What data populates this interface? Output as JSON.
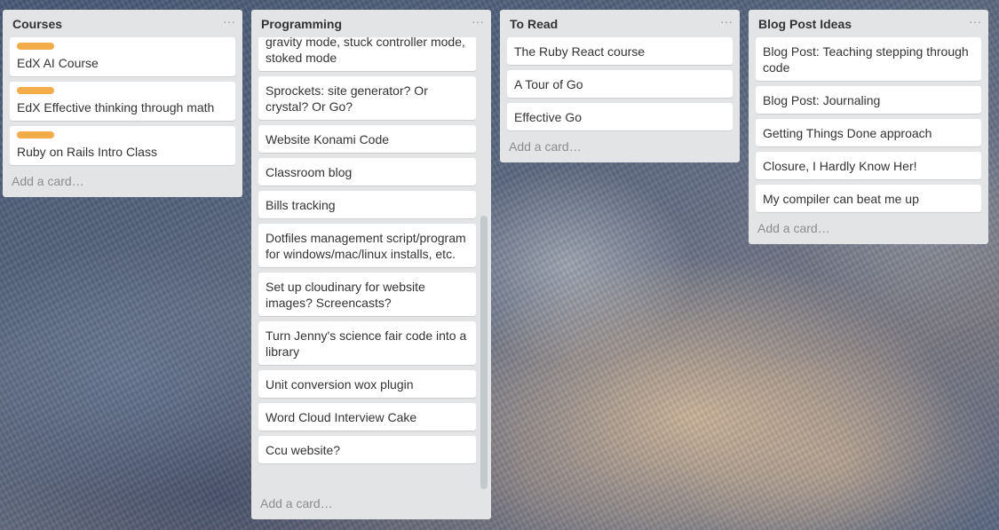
{
  "lists": [
    {
      "title": "Courses",
      "menu": "···",
      "add_card": "Add a card…",
      "cards": [
        {
          "text": "EdX AI Course",
          "label": true
        },
        {
          "text": "EdX Effective thinking through math",
          "label": true
        },
        {
          "text": "Ruby on Rails Intro Class",
          "label": true
        }
      ]
    },
    {
      "title": "Programming",
      "menu": "···",
      "add_card": "Add a card…",
      "cards": [
        {
          "text": "gravity mode, stuck controller mode, stoked mode"
        },
        {
          "text": "Sprockets: site generator? Or crystal? Or Go?"
        },
        {
          "text": "Website Konami Code"
        },
        {
          "text": "Classroom blog"
        },
        {
          "text": "Bills tracking"
        },
        {
          "text": "Dotfiles management script/program for windows/mac/linux installs, etc."
        },
        {
          "text": "Set up cloudinary for website images? Screencasts?"
        },
        {
          "text": "Turn Jenny's science fair code into a library"
        },
        {
          "text": "Unit conversion wox plugin"
        },
        {
          "text": "Word Cloud Interview Cake"
        },
        {
          "text": "Ccu website?"
        }
      ]
    },
    {
      "title": "To Read",
      "menu": "···",
      "add_card": "Add a card…",
      "cards": [
        {
          "text": "The Ruby React course"
        },
        {
          "text": "A Tour of Go"
        },
        {
          "text": "Effective Go"
        }
      ]
    },
    {
      "title": "Blog Post Ideas",
      "menu": "···",
      "add_card": "Add a card…",
      "cards": [
        {
          "text": "Blog Post: Teaching stepping through code"
        },
        {
          "text": "Blog Post: Journaling"
        },
        {
          "text": "Getting Things Done approach"
        },
        {
          "text": "Closure, I Hardly Know Her!"
        },
        {
          "text": "My compiler can beat me up"
        }
      ]
    }
  ],
  "colors": {
    "label": "#f2ac4a",
    "list_bg": "#e2e4e6"
  }
}
